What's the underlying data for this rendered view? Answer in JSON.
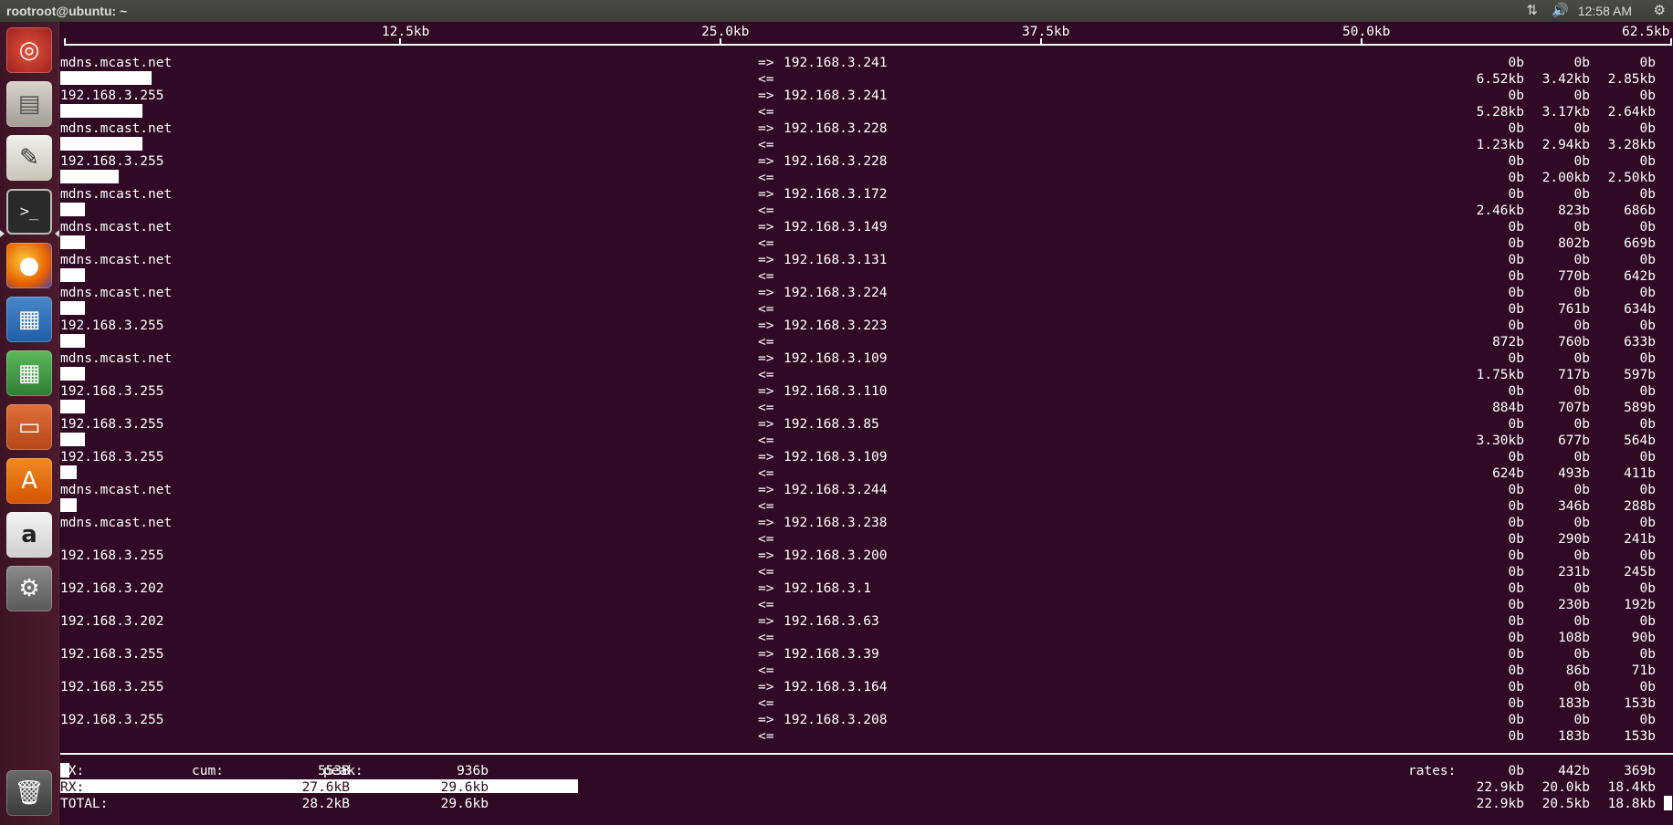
{
  "topbar": {
    "title": "rootroot@ubuntu: ~",
    "clock": "12:58 AM",
    "icons": [
      "network-arrows-icon",
      "volume-icon",
      "settings-gear-icon"
    ]
  },
  "launcher": {
    "items": [
      "ubuntu-dash",
      "files",
      "text-editor",
      "terminal",
      "firefox",
      "libreoffice-writer",
      "libreoffice-calc",
      "libreoffice-impress",
      "software-center",
      "amazon",
      "system-settings",
      "trash"
    ]
  },
  "scale": [
    "12.5kb",
    "25.0kb",
    "37.5kb",
    "50.0kb",
    "62.5kb"
  ],
  "rows": [
    {
      "src": "mdns.mcast.net",
      "dst": "192.168.3.241",
      "tx": [
        "0b",
        "0b",
        "0b"
      ],
      "rx": [
        "6.52kb",
        "3.42kb",
        "2.85kb"
      ]
    },
    {
      "src": "192.168.3.255",
      "dst": "192.168.3.241",
      "tx": [
        "0b",
        "0b",
        "0b"
      ],
      "rx": [
        "5.28kb",
        "3.17kb",
        "2.64kb"
      ]
    },
    {
      "src": "mdns.mcast.net",
      "dst": "192.168.3.228",
      "tx": [
        "0b",
        "0b",
        "0b"
      ],
      "rx": [
        "1.23kb",
        "2.94kb",
        "3.28kb"
      ]
    },
    {
      "src": "192.168.3.255",
      "dst": "192.168.3.228",
      "tx": [
        "0b",
        "0b",
        "0b"
      ],
      "rx": [
        "0b",
        "2.00kb",
        "2.50kb"
      ]
    },
    {
      "src": "mdns.mcast.net",
      "dst": "192.168.3.172",
      "tx": [
        "0b",
        "0b",
        "0b"
      ],
      "rx": [
        "2.46kb",
        "823b",
        "686b"
      ]
    },
    {
      "src": "mdns.mcast.net",
      "dst": "192.168.3.149",
      "tx": [
        "0b",
        "0b",
        "0b"
      ],
      "rx": [
        "0b",
        "802b",
        "669b"
      ]
    },
    {
      "src": "mdns.mcast.net",
      "dst": "192.168.3.131",
      "tx": [
        "0b",
        "0b",
        "0b"
      ],
      "rx": [
        "0b",
        "770b",
        "642b"
      ]
    },
    {
      "src": "mdns.mcast.net",
      "dst": "192.168.3.224",
      "tx": [
        "0b",
        "0b",
        "0b"
      ],
      "rx": [
        "0b",
        "761b",
        "634b"
      ]
    },
    {
      "src": "192.168.3.255",
      "dst": "192.168.3.223",
      "tx": [
        "0b",
        "0b",
        "0b"
      ],
      "rx": [
        "872b",
        "760b",
        "633b"
      ]
    },
    {
      "src": "mdns.mcast.net",
      "dst": "192.168.3.109",
      "tx": [
        "0b",
        "0b",
        "0b"
      ],
      "rx": [
        "1.75kb",
        "717b",
        "597b"
      ]
    },
    {
      "src": "192.168.3.255",
      "dst": "192.168.3.110",
      "tx": [
        "0b",
        "0b",
        "0b"
      ],
      "rx": [
        "884b",
        "707b",
        "589b"
      ]
    },
    {
      "src": "192.168.3.255",
      "dst": "192.168.3.85",
      "tx": [
        "0b",
        "0b",
        "0b"
      ],
      "rx": [
        "3.30kb",
        "677b",
        "564b"
      ]
    },
    {
      "src": "192.168.3.255",
      "dst": "192.168.3.109",
      "tx": [
        "0b",
        "0b",
        "0b"
      ],
      "rx": [
        "624b",
        "493b",
        "411b"
      ]
    },
    {
      "src": "mdns.mcast.net",
      "dst": "192.168.3.244",
      "tx": [
        "0b",
        "0b",
        "0b"
      ],
      "rx": [
        "0b",
        "346b",
        "288b"
      ]
    },
    {
      "src": "mdns.mcast.net",
      "dst": "192.168.3.238",
      "tx": [
        "0b",
        "0b",
        "0b"
      ],
      "rx": [
        "0b",
        "290b",
        "241b"
      ]
    },
    {
      "src": "192.168.3.255",
      "dst": "192.168.3.200",
      "tx": [
        "0b",
        "0b",
        "0b"
      ],
      "rx": [
        "0b",
        "231b",
        "245b"
      ]
    },
    {
      "src": "192.168.3.202",
      "dst": "192.168.3.1",
      "tx": [
        "0b",
        "0b",
        "0b"
      ],
      "rx": [
        "0b",
        "230b",
        "192b"
      ]
    },
    {
      "src": "192.168.3.202",
      "dst": "192.168.3.63",
      "tx": [
        "0b",
        "0b",
        "0b"
      ],
      "rx": [
        "0b",
        "108b",
        "90b"
      ]
    },
    {
      "src": "192.168.3.255",
      "dst": "192.168.3.39",
      "tx": [
        "0b",
        "0b",
        "0b"
      ],
      "rx": [
        "0b",
        "86b",
        "71b"
      ]
    },
    {
      "src": "192.168.3.255",
      "dst": "192.168.3.164",
      "tx": [
        "0b",
        "0b",
        "0b"
      ],
      "rx": [
        "0b",
        "183b",
        "153b"
      ]
    },
    {
      "src": "192.168.3.255",
      "dst": "192.168.3.208",
      "tx": [
        "0b",
        "0b",
        "0b"
      ],
      "rx": [
        "0b",
        "183b",
        "153b"
      ]
    }
  ],
  "arrows": {
    "tx": "=>",
    "rx": "<="
  },
  "totals": {
    "tx_label": "TX:",
    "rx_label": "RX:",
    "total_label": "TOTAL:",
    "cum_label": "cum:",
    "peak_label": "peak:",
    "rates_label": "rates:",
    "tx_cum": "553B",
    "tx_peak": "936b",
    "rx_cum": "27.6kB",
    "rx_peak": "29.6kb",
    "total_cum": "28.2kB",
    "total_peak": "29.6kb",
    "tx_rates": [
      "0b",
      "442b",
      "369b"
    ],
    "rx_rates": [
      "22.9kb",
      "20.0kb",
      "18.4kb"
    ],
    "total_rates": [
      "22.9kb",
      "20.5kb",
      "18.8kb"
    ]
  }
}
